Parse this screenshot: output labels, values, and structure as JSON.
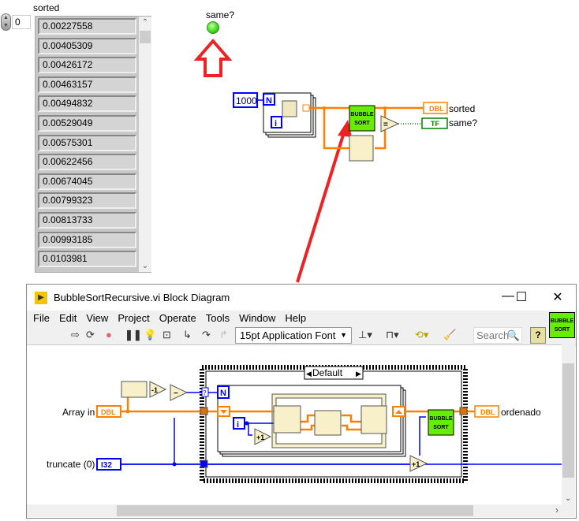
{
  "front_panel": {
    "index_value": "0",
    "array_label": "sorted",
    "array_values": [
      "0.00227558",
      "0.00405309",
      "0.00426172",
      "0.00463157",
      "0.00494832",
      "0.00529049",
      "0.00575301",
      "0.00622456",
      "0.00674045",
      "0.00799323",
      "0.00813733",
      "0.00993185",
      "0.0103981"
    ],
    "led_label": "same?",
    "led_color": "#44dd22"
  },
  "top_diagram": {
    "n_constant": "1000",
    "n_terminal": "N",
    "i_terminal": "i",
    "subvi_label": [
      "BUBBLE",
      "SORT"
    ],
    "sorted_indicator": "DBL",
    "sorted_label": "sorted",
    "same_indicator": "TF",
    "same_label": "same?",
    "annotation_color": "#ee2222"
  },
  "window": {
    "title": "BubbleSortRecursive.vi Block Diagram",
    "controls": {
      "minimize": "—",
      "maximize": "☐",
      "close": "✕"
    },
    "menu": [
      "File",
      "Edit",
      "View",
      "Project",
      "Operate",
      "Tools",
      "Window",
      "Help"
    ],
    "toolbar": {
      "font": "15pt Application Font",
      "search_placeholder": "Search",
      "help": "?"
    },
    "vi_icon": [
      "BUBBLE",
      "SORT"
    ]
  },
  "block_diagram": {
    "array_in_label": "Array in",
    "array_in_terminal": "DBL",
    "truncate_label": "truncate (0)",
    "truncate_terminal": "I32",
    "case_selector": "Default",
    "decrement": "-1",
    "subtract": "−",
    "increment": "+1",
    "increment2": "+1",
    "n_terminal": "N",
    "i_terminal": "i",
    "question": "?",
    "subvi_label": [
      "BUBBLE",
      "SORT"
    ],
    "output_terminal": "DBL",
    "output_label": "ordenado",
    "wire_colors": {
      "dbl": "#ff8000",
      "int": "#0000ff",
      "bool": "#008000"
    }
  }
}
